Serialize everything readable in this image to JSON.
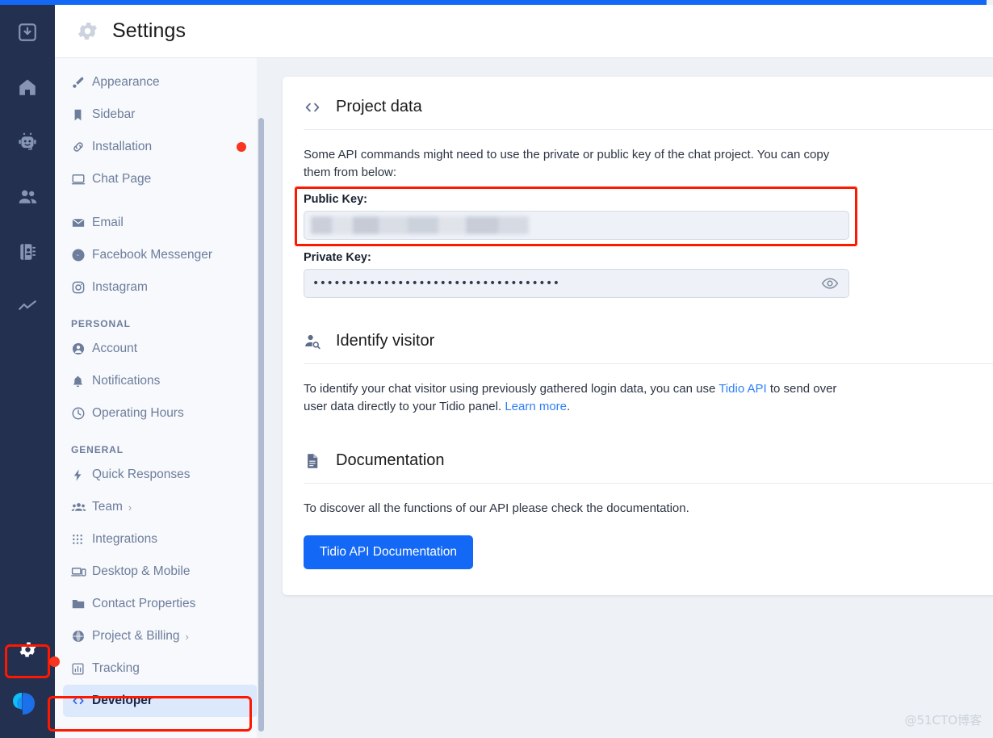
{
  "top_bar": {
    "color": "#1369f5"
  },
  "icon_rail": {
    "background": "#23304f",
    "items": [
      {
        "name": "inbox-icon",
        "label": "Inbox"
      },
      {
        "name": "home-icon",
        "label": "Home"
      },
      {
        "name": "chatbot-icon",
        "label": "Chatbots"
      },
      {
        "name": "visitors-icon",
        "label": "Visitors"
      },
      {
        "name": "contacts-icon",
        "label": "Contacts"
      },
      {
        "name": "analytics-icon",
        "label": "Analytics"
      }
    ],
    "gear": {
      "name": "gear-icon",
      "label": "Settings",
      "has_notification_dot": true
    },
    "logo": {
      "name": "tidio-logo",
      "label": "Tidio"
    }
  },
  "header": {
    "icon": "gear-icon",
    "title": "Settings"
  },
  "sidebar": {
    "groups": [
      {
        "title": "",
        "items": [
          {
            "label": "Appearance",
            "icon": "brush-icon",
            "active": false,
            "dot": false,
            "chevron": false
          },
          {
            "label": "Sidebar",
            "icon": "bookmark-icon",
            "active": false,
            "dot": false,
            "chevron": false
          },
          {
            "label": "Installation",
            "icon": "link-icon",
            "active": false,
            "dot": true,
            "chevron": false
          },
          {
            "label": "Chat Page",
            "icon": "monitor-icon",
            "active": false,
            "dot": false,
            "chevron": false
          }
        ]
      },
      {
        "title": "",
        "items": [
          {
            "label": "Email",
            "icon": "envelope-icon",
            "active": false,
            "dot": false,
            "chevron": false
          },
          {
            "label": "Facebook Messenger",
            "icon": "messenger-icon",
            "active": false,
            "dot": false,
            "chevron": false
          },
          {
            "label": "Instagram",
            "icon": "instagram-icon",
            "active": false,
            "dot": false,
            "chevron": false
          }
        ]
      },
      {
        "title": "PERSONAL",
        "items": [
          {
            "label": "Account",
            "icon": "user-circle-icon",
            "active": false,
            "dot": false,
            "chevron": false
          },
          {
            "label": "Notifications",
            "icon": "bell-icon",
            "active": false,
            "dot": false,
            "chevron": false
          },
          {
            "label": "Operating Hours",
            "icon": "clock-icon",
            "active": false,
            "dot": false,
            "chevron": false
          }
        ]
      },
      {
        "title": "GENERAL",
        "items": [
          {
            "label": "Quick Responses",
            "icon": "bolt-icon",
            "active": false,
            "dot": false,
            "chevron": false
          },
          {
            "label": "Team",
            "icon": "team-icon",
            "active": false,
            "dot": false,
            "chevron": true
          },
          {
            "label": "Integrations",
            "icon": "grid-icon",
            "active": false,
            "dot": false,
            "chevron": false
          },
          {
            "label": "Desktop & Mobile",
            "icon": "devices-icon",
            "active": false,
            "dot": false,
            "chevron": false
          },
          {
            "label": "Contact Properties",
            "icon": "folder-icon",
            "active": false,
            "dot": false,
            "chevron": false
          },
          {
            "label": "Project & Billing",
            "icon": "globe-icon",
            "active": false,
            "dot": false,
            "chevron": true
          },
          {
            "label": "Tracking",
            "icon": "chart-icon",
            "active": false,
            "dot": false,
            "chevron": false
          },
          {
            "label": "Developer",
            "icon": "code-icon",
            "active": true,
            "dot": false,
            "chevron": false
          }
        ]
      }
    ],
    "chevron_glyph": "›"
  },
  "main": {
    "project_data": {
      "icon": "code-icon",
      "title": "Project data",
      "description": "Some API commands might need to use the private or public key of the chat project. You can copy them from below:",
      "public_key_label": "Public Key:",
      "public_key_value": "",
      "private_key_label": "Private Key:",
      "private_key_value": "•••••••••••••••••••••••••••••••••••",
      "reveal_icon": "eye-icon"
    },
    "identify_visitor": {
      "icon": "user-search-icon",
      "title": "Identify visitor",
      "text_before_link": "To identify your chat visitor using previously gathered login data, you can use ",
      "link1": "Tidio API",
      "text_between": " to send over user data directly to your Tidio panel. ",
      "link2": "Learn more",
      "text_after": "."
    },
    "documentation": {
      "icon": "document-icon",
      "title": "Documentation",
      "text": "To discover all the functions of our API please check the documentation.",
      "button_label": "Tidio API Documentation",
      "button_color": "#1369f5"
    }
  },
  "annotations": {
    "color": "#ff1800",
    "boxes": [
      "gear-rail-item",
      "public-key-field",
      "developer-sidebar-item"
    ]
  },
  "watermark": {
    "text": "@51CTO博客"
  }
}
